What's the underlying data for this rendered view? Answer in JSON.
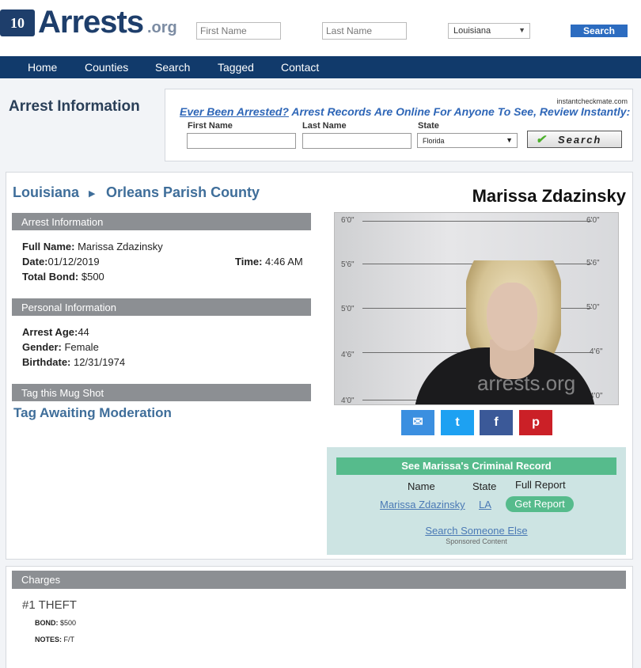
{
  "header": {
    "logo_mark": "10",
    "logo_text": "Arrests",
    "logo_tld": ".org",
    "first_name_placeholder": "First Name",
    "last_name_placeholder": "Last Name",
    "state_selected": "Louisiana",
    "search_label": "Search"
  },
  "nav": {
    "items": [
      "Home",
      "Counties",
      "Search",
      "Tagged",
      "Contact"
    ]
  },
  "page_title": "Arrest Information",
  "ad": {
    "source": "instantcheckmate.com",
    "headline_underlined": "Ever Been Arrested?",
    "headline_rest": " Arrest Records Are Online For Anyone To See, Review Instantly:",
    "first_name_label": "First Name",
    "last_name_label": "Last Name",
    "state_label": "State",
    "state_selected": "Florida",
    "search_label": "Search"
  },
  "breadcrumb": {
    "state": "Louisiana",
    "separator": "▶",
    "county": "Orleans Parish County"
  },
  "person_name": "Marissa Zdazinsky",
  "arrest_info": {
    "section_title": "Arrest Information",
    "full_name_label": "Full Name:",
    "full_name": " Marissa Zdazinsky",
    "date_label": "Date:",
    "date": "01/12/2019",
    "time_label": "Time:",
    "time": " 4:46 AM",
    "bond_label": "Total Bond:",
    "bond": " $500"
  },
  "personal_info": {
    "section_title": "Personal Information",
    "age_label": "Arrest Age:",
    "age": "44",
    "gender_label": "Gender:",
    "gender": " Female",
    "birthdate_label": "Birthdate:",
    "birthdate": " 12/31/1974"
  },
  "tag": {
    "section_title": "Tag this Mug Shot",
    "status": "Tag Awaiting Moderation"
  },
  "mugshot": {
    "ruler_labels_left": [
      "6'0\"",
      "5'6\"",
      "5'0\"",
      "4'6\"",
      "4'0\""
    ],
    "ruler_labels_right": [
      "6'0\"",
      "5'6\"",
      "5'0\"",
      "4'6\"",
      "4'0\""
    ],
    "watermark": "arrests.org"
  },
  "share": {
    "email_icon": "✉",
    "twitter_icon": "t",
    "facebook_icon": "f",
    "pinterest_icon": "p",
    "colors": {
      "email": "#3b8fe0",
      "twitter": "#1da1f2",
      "facebook": "#3b5998",
      "pinterest": "#cb2027"
    }
  },
  "record": {
    "heading": "See Marissa's Criminal Record",
    "col_name": "Name",
    "col_state": "State",
    "col_report": "Full Report",
    "name": "Marissa Zdazinsky",
    "state": "LA",
    "report_button": "Get Report",
    "search_else": "Search Someone Else",
    "sponsored": "Sponsored Content"
  },
  "charges": {
    "section_title": "Charges",
    "items": [
      {
        "title": "#1 THEFT",
        "bond_label": "BOND:",
        "bond": " $500",
        "notes_label": "NOTES:",
        "notes": " F/T"
      }
    ]
  }
}
